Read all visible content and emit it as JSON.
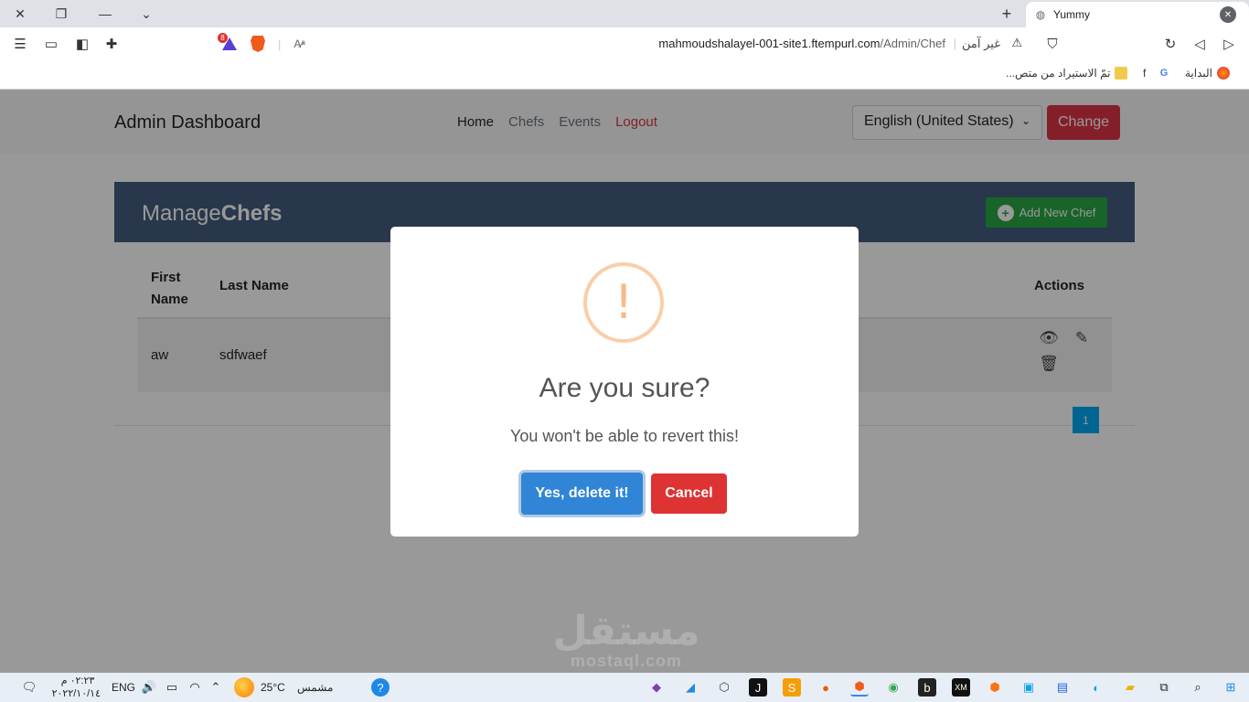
{
  "browser": {
    "tab_title": "Yummy",
    "url_host": "mahmoudshalayel-001-site1.ftempurl.com",
    "url_path": "/Admin/Chef",
    "security_label": "غير آمن",
    "shields_count": "8",
    "bookmarks": [
      {
        "label": "البداية",
        "icon": "firefox-icon"
      },
      {
        "label": "",
        "icon": "google-icon"
      },
      {
        "label": "f",
        "icon": "facebook-icon"
      },
      {
        "label": "تمّ الاستيراد من متص...",
        "icon": "folder-icon"
      }
    ]
  },
  "navbar": {
    "brand": "Admin Dashboard",
    "links": [
      "Home",
      "Chefs",
      "Events",
      "Logout"
    ],
    "language_selected": "English (United States)",
    "change_label": "Change"
  },
  "manage": {
    "title_light": "Manage",
    "title_bold": "Chefs",
    "add_label": "Add New Chef"
  },
  "table": {
    "headers": {
      "first_line1": "First",
      "first_line2": "Name",
      "last": "Last Name",
      "actions": "Actions"
    },
    "rows": [
      {
        "first": "aw",
        "last": "sdfwaef"
      }
    ]
  },
  "pagination": {
    "current": "1"
  },
  "dialog": {
    "icon": "!",
    "title": "Are you sure?",
    "text": "You won't be able to revert this!",
    "confirm_label": "Yes, delete it!",
    "cancel_label": "Cancel"
  },
  "watermark": {
    "arabic": "مستقل",
    "latin": "mostaql.com"
  },
  "taskbar": {
    "time": "٠٢:٢٣ م",
    "date": "٢٠٢٢/١٠/١٤",
    "language": "ENG",
    "temperature": "25°C",
    "weather": "مشمس"
  },
  "colors": {
    "header_bg": "#435d7d",
    "confirm": "#3085d6",
    "cancel": "#dd3333",
    "warning": "#f8bb86",
    "add_button": "#28a745",
    "change_button": "#dc3545"
  }
}
